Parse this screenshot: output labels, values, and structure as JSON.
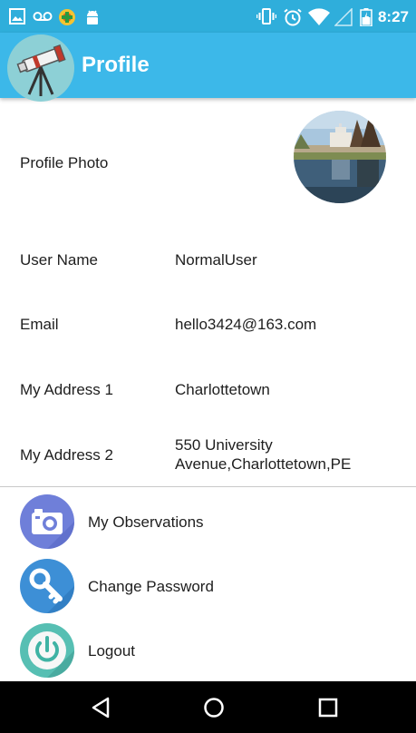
{
  "status_bar": {
    "time": "8:27",
    "icons": [
      "image-icon",
      "voicemail-icon",
      "app-badge-icon",
      "android-icon",
      "vibrate-icon",
      "alarm-icon",
      "wifi-icon",
      "signal-icon",
      "battery-icon"
    ]
  },
  "app_bar": {
    "title": "Profile",
    "logo_icon": "telescope-icon",
    "color": "#3cb8e9"
  },
  "profile": {
    "photo_label": "Profile Photo",
    "username_label": "User Name",
    "username_value": "NormalUser",
    "email_label": "Email",
    "email_value": "hello3424@163.com",
    "address1_label": "My Address 1",
    "address1_value": "Charlottetown",
    "address2_label": "My Address 2",
    "address2_value_line1": "550 University",
    "address2_value_line2": "Avenue,Charlottetown,PE"
  },
  "menu": {
    "items": [
      {
        "label": "My Observations",
        "icon": "camera-icon",
        "color": "#6f7fd9"
      },
      {
        "label": "Change Password",
        "icon": "key-icon",
        "color": "#3d8fd6"
      },
      {
        "label": "Logout",
        "icon": "power-icon",
        "color": "#57bfb3"
      }
    ]
  },
  "nav_bar": {
    "buttons": [
      "back-icon",
      "home-icon",
      "recents-icon"
    ]
  }
}
